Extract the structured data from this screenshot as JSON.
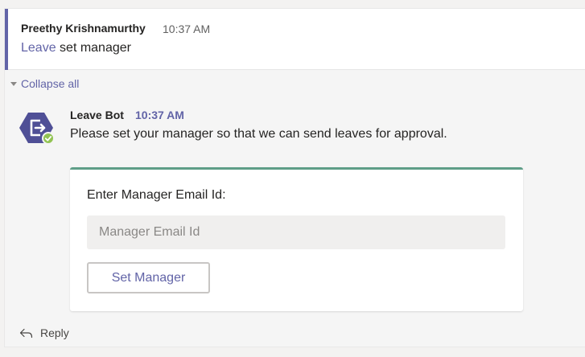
{
  "root_message": {
    "author": "Preethy Krishnamurthy",
    "time": "10:37 AM",
    "link_text": "Leave",
    "text": " set manager"
  },
  "collapse_label": "Collapse all",
  "bot_message": {
    "name": "Leave Bot",
    "time": "10:37 AM",
    "text": "Please set your manager so that we can send leaves for approval.",
    "status": "available",
    "colors": {
      "avatar_bg": "#4f4f96",
      "status": "#92c353",
      "accent": "#6264a7",
      "card_top": "#5f9e88"
    }
  },
  "card": {
    "label": "Enter Manager Email Id:",
    "input_placeholder": "Manager Email Id",
    "input_value": "",
    "button_label": "Set Manager"
  },
  "reply_label": "Reply",
  "icons": {
    "avatar": "exit-arrow-icon",
    "status": "check-icon",
    "reply": "reply-arrow-icon",
    "collapse": "triangle-down-icon"
  }
}
